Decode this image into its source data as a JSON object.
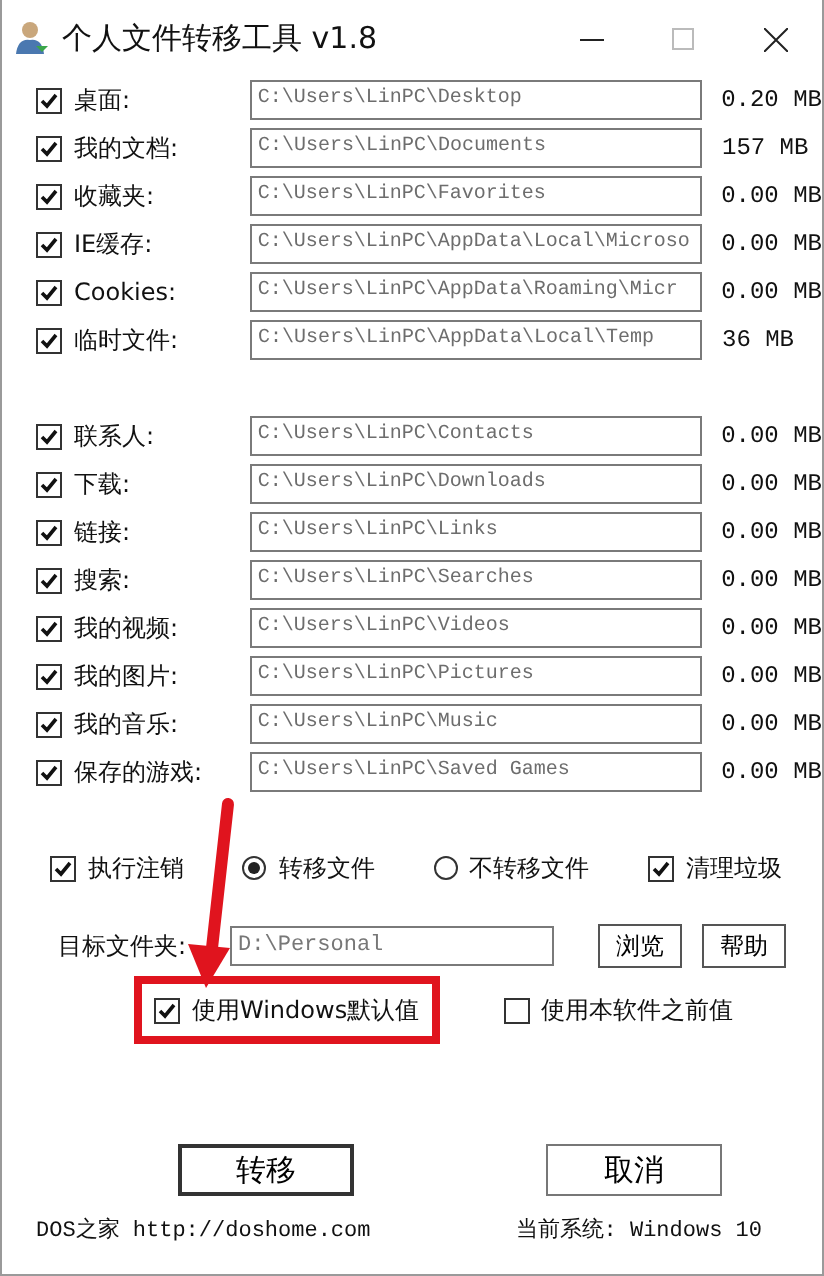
{
  "window": {
    "title": "个人文件转移工具 v1.8"
  },
  "folder_groups": [
    {
      "items": [
        {
          "label": "桌面:",
          "path": "C:\\Users\\LinPC\\Desktop",
          "size": "0.20 MB",
          "checked": true
        },
        {
          "label": "我的文档:",
          "path": "C:\\Users\\LinPC\\Documents",
          "size": "157 MB",
          "checked": true
        },
        {
          "label": "收藏夹:",
          "path": "C:\\Users\\LinPC\\Favorites",
          "size": "0.00 MB",
          "checked": true
        },
        {
          "label": "IE缓存:",
          "path": "C:\\Users\\LinPC\\AppData\\Local\\Microso",
          "size": "0.00 MB",
          "checked": true
        },
        {
          "label": "Cookies:",
          "path": "C:\\Users\\LinPC\\AppData\\Roaming\\Micr",
          "size": "0.00 MB",
          "checked": true
        },
        {
          "label": "临时文件:",
          "path": "C:\\Users\\LinPC\\AppData\\Local\\Temp",
          "size": "36 MB",
          "checked": true
        }
      ]
    },
    {
      "items": [
        {
          "label": "联系人:",
          "path": "C:\\Users\\LinPC\\Contacts",
          "size": "0.00 MB",
          "checked": true
        },
        {
          "label": "下载:",
          "path": "C:\\Users\\LinPC\\Downloads",
          "size": "0.00 MB",
          "checked": true
        },
        {
          "label": "链接:",
          "path": "C:\\Users\\LinPC\\Links",
          "size": "0.00 MB",
          "checked": true
        },
        {
          "label": "搜索:",
          "path": "C:\\Users\\LinPC\\Searches",
          "size": "0.00 MB",
          "checked": true
        },
        {
          "label": "我的视频:",
          "path": "C:\\Users\\LinPC\\Videos",
          "size": "0.00 MB",
          "checked": true
        },
        {
          "label": "我的图片:",
          "path": "C:\\Users\\LinPC\\Pictures",
          "size": "0.00 MB",
          "checked": true
        },
        {
          "label": "我的音乐:",
          "path": "C:\\Users\\LinPC\\Music",
          "size": "0.00 MB",
          "checked": true
        },
        {
          "label": "保存的游戏:",
          "path": "C:\\Users\\LinPC\\Saved Games",
          "size": "0.00 MB",
          "checked": true
        }
      ]
    }
  ],
  "options": [
    {
      "kind": "checkbox",
      "label": "执行注销",
      "checked": true
    },
    {
      "kind": "radio",
      "label": "转移文件",
      "selected": true
    },
    {
      "kind": "radio",
      "label": "不转移文件",
      "selected": false
    },
    {
      "kind": "checkbox",
      "label": "清理垃圾",
      "checked": true
    }
  ],
  "target": {
    "label": "目标文件夹:",
    "value": "D:\\Personal",
    "buttons": [
      "浏览",
      "帮助"
    ]
  },
  "defaults": [
    {
      "label": "使用Windows默认值",
      "checked": true,
      "annotated": true
    },
    {
      "label": "使用本软件之前值",
      "checked": false,
      "annotated": false
    }
  ],
  "actions": [
    {
      "label": "转移",
      "default": true
    },
    {
      "label": "取消",
      "default": false
    }
  ],
  "footer": {
    "left": "DOS之家 http://doshome.com",
    "right": "当前系统: Windows 10"
  }
}
